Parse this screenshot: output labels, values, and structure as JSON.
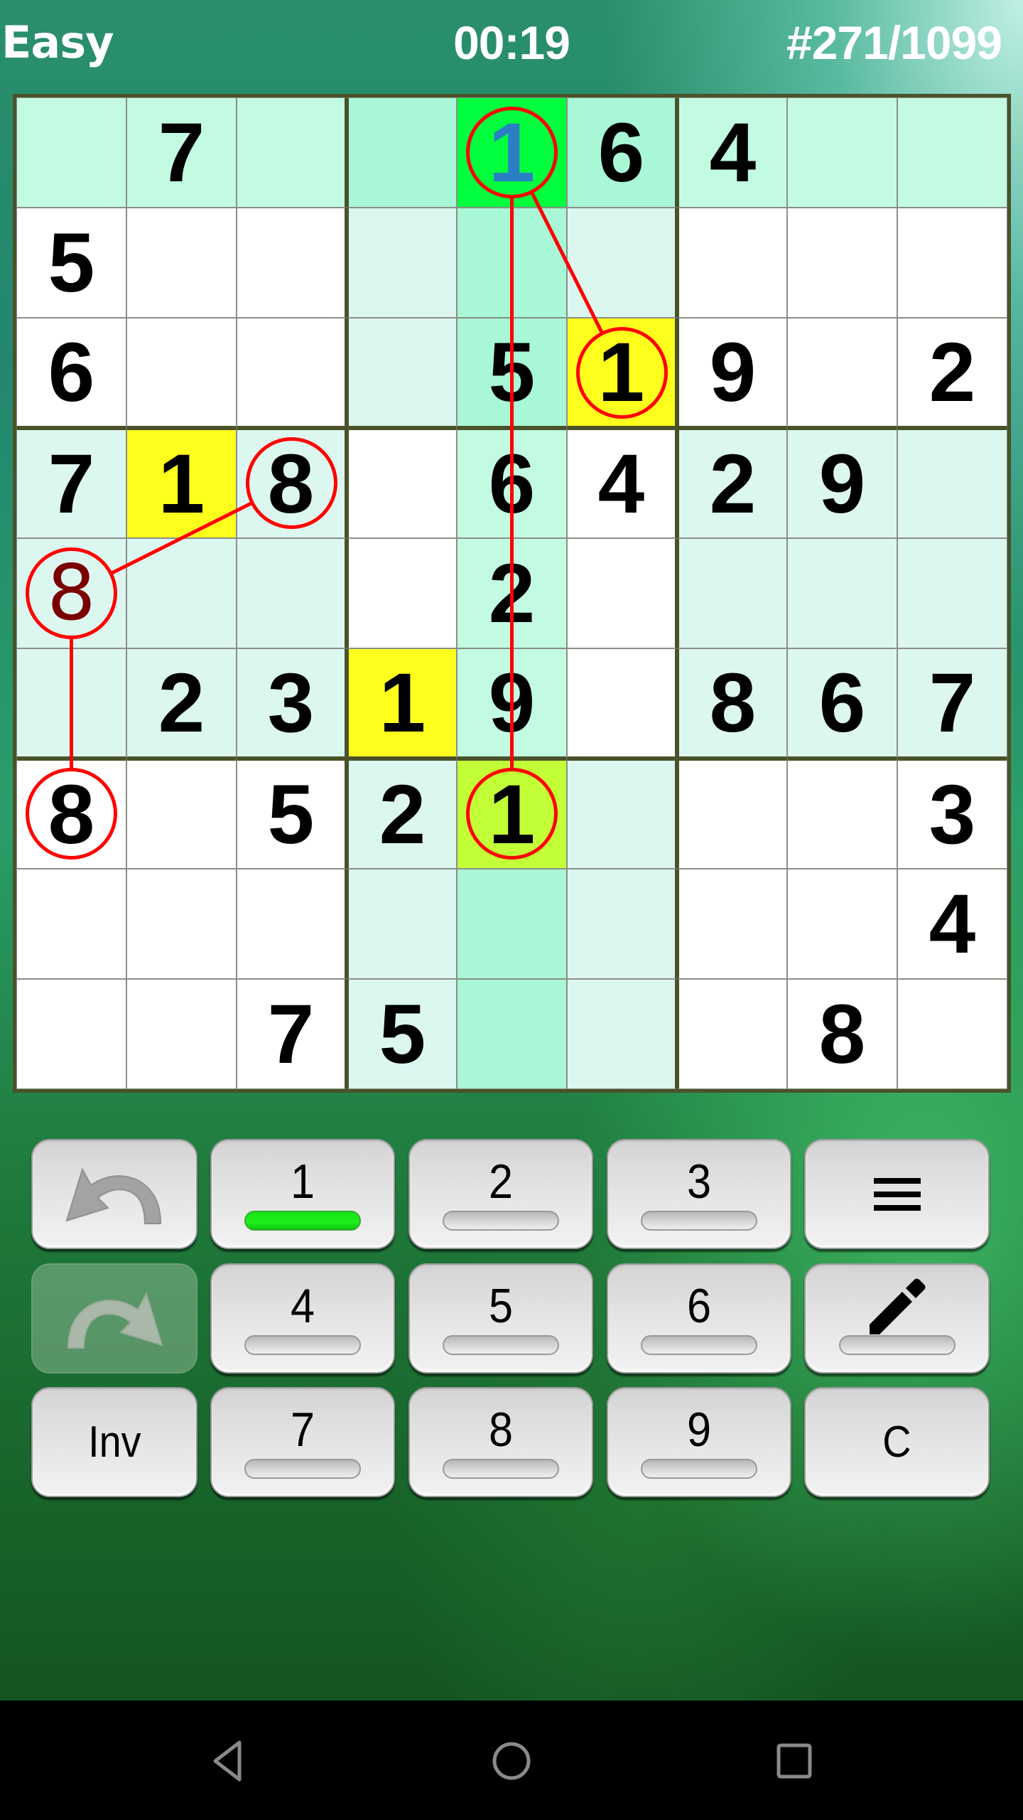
{
  "header": {
    "level": "Easy",
    "timer": "00:19",
    "puzzle": "#271/1099"
  },
  "colors": {
    "given_text": "#000000",
    "user_text": "#7a0000",
    "hint_text": "#2a7fc4",
    "selected_cell": "#00ff3c",
    "match_cell": "#ffff1e",
    "target_cell": "#c2ff36",
    "col_highlight": "#a8f7d6",
    "row_highlight": "#c2fbe2",
    "box_highlight": "#dcf7f0",
    "plain_cell": "#ffffff",
    "chain_red": "#ff0000",
    "board_border": "#4a5229",
    "bar_active": "#18e818"
  },
  "board": {
    "cells": [
      [
        {
          "v": "",
          "bg": "row_highlight"
        },
        {
          "v": "7",
          "bg": "row_highlight"
        },
        {
          "v": "",
          "bg": "row_highlight"
        },
        {
          "v": "",
          "bg": "col_highlight"
        },
        {
          "v": "1",
          "bg": "selected_cell",
          "kind": "hint"
        },
        {
          "v": "6",
          "bg": "col_highlight"
        },
        {
          "v": "4",
          "bg": "row_highlight"
        },
        {
          "v": "",
          "bg": "row_highlight"
        },
        {
          "v": "",
          "bg": "row_highlight"
        }
      ],
      [
        {
          "v": "5",
          "bg": "plain_cell"
        },
        {
          "v": "",
          "bg": "plain_cell"
        },
        {
          "v": "",
          "bg": "plain_cell"
        },
        {
          "v": "",
          "bg": "box_highlight"
        },
        {
          "v": "",
          "bg": "col_highlight"
        },
        {
          "v": "",
          "bg": "box_highlight"
        },
        {
          "v": "",
          "bg": "plain_cell"
        },
        {
          "v": "",
          "bg": "plain_cell"
        },
        {
          "v": "",
          "bg": "plain_cell"
        }
      ],
      [
        {
          "v": "6",
          "bg": "plain_cell"
        },
        {
          "v": "",
          "bg": "plain_cell"
        },
        {
          "v": "",
          "bg": "plain_cell"
        },
        {
          "v": "",
          "bg": "box_highlight"
        },
        {
          "v": "5",
          "bg": "col_highlight"
        },
        {
          "v": "1",
          "bg": "match_cell"
        },
        {
          "v": "9",
          "bg": "plain_cell"
        },
        {
          "v": "",
          "bg": "plain_cell"
        },
        {
          "v": "2",
          "bg": "plain_cell"
        }
      ],
      [
        {
          "v": "7",
          "bg": "box_highlight"
        },
        {
          "v": "1",
          "bg": "match_cell"
        },
        {
          "v": "8",
          "bg": "box_highlight"
        },
        {
          "v": "",
          "bg": "plain_cell"
        },
        {
          "v": "6",
          "bg": "row_highlight"
        },
        {
          "v": "4",
          "bg": "plain_cell"
        },
        {
          "v": "2",
          "bg": "box_highlight"
        },
        {
          "v": "9",
          "bg": "box_highlight"
        },
        {
          "v": "",
          "bg": "box_highlight"
        }
      ],
      [
        {
          "v": "8",
          "bg": "box_highlight",
          "kind": "user"
        },
        {
          "v": "",
          "bg": "box_highlight"
        },
        {
          "v": "",
          "bg": "box_highlight"
        },
        {
          "v": "",
          "bg": "plain_cell"
        },
        {
          "v": "2",
          "bg": "row_highlight"
        },
        {
          "v": "",
          "bg": "plain_cell"
        },
        {
          "v": "",
          "bg": "box_highlight"
        },
        {
          "v": "",
          "bg": "box_highlight"
        },
        {
          "v": "",
          "bg": "box_highlight"
        }
      ],
      [
        {
          "v": "",
          "bg": "box_highlight"
        },
        {
          "v": "2",
          "bg": "box_highlight"
        },
        {
          "v": "3",
          "bg": "box_highlight"
        },
        {
          "v": "1",
          "bg": "match_cell"
        },
        {
          "v": "9",
          "bg": "row_highlight"
        },
        {
          "v": "",
          "bg": "plain_cell"
        },
        {
          "v": "8",
          "bg": "box_highlight"
        },
        {
          "v": "6",
          "bg": "box_highlight"
        },
        {
          "v": "7",
          "bg": "box_highlight"
        }
      ],
      [
        {
          "v": "8",
          "bg": "plain_cell"
        },
        {
          "v": "",
          "bg": "plain_cell"
        },
        {
          "v": "5",
          "bg": "plain_cell"
        },
        {
          "v": "2",
          "bg": "box_highlight"
        },
        {
          "v": "1",
          "bg": "target_cell"
        },
        {
          "v": "",
          "bg": "box_highlight"
        },
        {
          "v": "",
          "bg": "plain_cell"
        },
        {
          "v": "",
          "bg": "plain_cell"
        },
        {
          "v": "3",
          "bg": "plain_cell"
        }
      ],
      [
        {
          "v": "",
          "bg": "plain_cell"
        },
        {
          "v": "",
          "bg": "plain_cell"
        },
        {
          "v": "",
          "bg": "plain_cell"
        },
        {
          "v": "",
          "bg": "box_highlight"
        },
        {
          "v": "",
          "bg": "col_highlight"
        },
        {
          "v": "",
          "bg": "box_highlight"
        },
        {
          "v": "",
          "bg": "plain_cell"
        },
        {
          "v": "",
          "bg": "plain_cell"
        },
        {
          "v": "4",
          "bg": "plain_cell"
        }
      ],
      [
        {
          "v": "",
          "bg": "plain_cell"
        },
        {
          "v": "",
          "bg": "plain_cell"
        },
        {
          "v": "7",
          "bg": "plain_cell"
        },
        {
          "v": "5",
          "bg": "box_highlight"
        },
        {
          "v": "",
          "bg": "col_highlight"
        },
        {
          "v": "",
          "bg": "box_highlight"
        },
        {
          "v": "",
          "bg": "plain_cell"
        },
        {
          "v": "8",
          "bg": "plain_cell"
        },
        {
          "v": "",
          "bg": "plain_cell"
        }
      ]
    ],
    "circles": [
      {
        "row": 1,
        "col": 5
      },
      {
        "row": 3,
        "col": 6
      },
      {
        "row": 7,
        "col": 5
      },
      {
        "row": 4,
        "col": 3
      },
      {
        "row": 5,
        "col": 1
      },
      {
        "row": 7,
        "col": 1
      }
    ],
    "links": [
      {
        "from": [
          1,
          5
        ],
        "to": [
          3,
          6
        ]
      },
      {
        "from": [
          1,
          5
        ],
        "to": [
          7,
          5
        ]
      },
      {
        "from": [
          4,
          3
        ],
        "to": [
          5,
          1
        ]
      },
      {
        "from": [
          5,
          1
        ],
        "to": [
          7,
          1
        ]
      }
    ]
  },
  "keypad": {
    "undo": {
      "icon": "undo-icon",
      "enabled": true
    },
    "redo": {
      "icon": "redo-icon",
      "enabled": false
    },
    "inv_label": "Inv",
    "menu": {
      "icon": "menu-icon"
    },
    "pencil": {
      "icon": "pencil-icon"
    },
    "clear_label": "C",
    "digits": [
      {
        "label": "1",
        "active": true
      },
      {
        "label": "2",
        "active": false
      },
      {
        "label": "3",
        "active": false
      },
      {
        "label": "4",
        "active": false
      },
      {
        "label": "5",
        "active": false
      },
      {
        "label": "6",
        "active": false
      },
      {
        "label": "7",
        "active": false
      },
      {
        "label": "8",
        "active": false
      },
      {
        "label": "9",
        "active": false
      }
    ]
  },
  "navbar": {
    "back": "back-icon",
    "home": "home-icon",
    "recents": "recents-icon"
  }
}
